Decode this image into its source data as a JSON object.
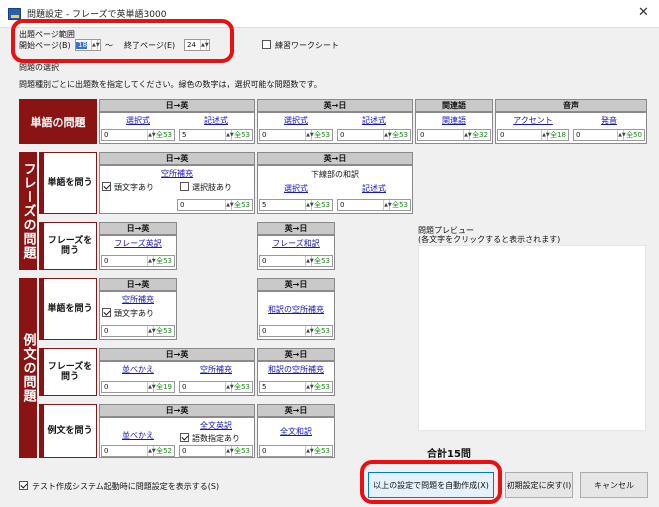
{
  "window": {
    "title": "問題設定 - フレーズで英単語3000",
    "close_label": "✕"
  },
  "range": {
    "group_label": "出題ページ範囲",
    "start_label": "開始ページ(B)",
    "start_value": "18",
    "tilde": "〜",
    "end_label": "終了ページ(E)",
    "end_value": "24",
    "worksheet_label": "練習ワークシート",
    "worksheet_checked": false
  },
  "selection": {
    "group_label": "問題の選択",
    "hint": "問題種別ごとに出題数を指定してください。緑色の数字は，選択可能な問題数です。"
  },
  "word": {
    "section_label": "単語の問題",
    "groups": [
      {
        "header": "日→英",
        "items": [
          {
            "label": "選択式",
            "value": "0",
            "total": "全53"
          },
          {
            "label": "記述式",
            "value": "5",
            "total": "全53"
          }
        ]
      },
      {
        "header": "英→日",
        "items": [
          {
            "label": "選択式",
            "value": "0",
            "total": "全53"
          },
          {
            "label": "記述式",
            "value": "0",
            "total": "全53"
          }
        ]
      },
      {
        "header": "関連語",
        "items": [
          {
            "label": "関連語",
            "value": "0",
            "total": "全32"
          }
        ]
      },
      {
        "header": "音声",
        "items": [
          {
            "label": "アクセント",
            "value": "0",
            "total": "全18"
          },
          {
            "label": "発音",
            "value": "0",
            "total": "全50"
          }
        ]
      }
    ]
  },
  "phrase": {
    "section_label": "フレーズの問題",
    "ask_word": {
      "label": "単語を問う",
      "ej": {
        "header": "日→英",
        "item": "空所補充",
        "opt1": "頭文字あり",
        "opt1_checked": true,
        "opt2": "選択肢あり",
        "opt2_checked": false,
        "value": "0",
        "total": "全53"
      },
      "je": {
        "header": "英→日",
        "sub": "下線部の和訳",
        "items": [
          {
            "label": "選択式",
            "value": "5",
            "total": "全53"
          },
          {
            "label": "記述式",
            "value": "0",
            "total": "全53"
          }
        ]
      }
    },
    "ask_phrase": {
      "label": "フレーズを問う",
      "ej": {
        "header": "日→英",
        "item": "フレーズ英訳",
        "value": "0",
        "total": "全53"
      },
      "je": {
        "header": "英→日",
        "item": "フレーズ和訳",
        "value": "0",
        "total": "全53"
      }
    }
  },
  "example": {
    "section_label": "例文の問題",
    "ask_word": {
      "label": "単語を問う",
      "ej": {
        "item": "空所補充",
        "opt": "頭文字あり",
        "opt_checked": true,
        "value": "0",
        "total": "全53"
      },
      "je": {
        "item": "和訳の空所補充",
        "value": "0",
        "total": "全53"
      }
    },
    "ask_phrase": {
      "label": "フレーズを問う",
      "ej": {
        "header": "日→英",
        "items": [
          {
            "label": "並べかえ",
            "value": "0",
            "total": "全19"
          },
          {
            "label": "空所補充",
            "value": "0",
            "total": "全53"
          }
        ]
      },
      "je": {
        "header": "英→日",
        "item": "和訳の空所補充",
        "value": "5",
        "total": "全53"
      }
    },
    "ask_sentence": {
      "label": "例文を問う",
      "ej": {
        "header": "日→英",
        "items": [
          {
            "label": "並べかえ",
            "value": "0",
            "total": "全52"
          },
          {
            "label": "全文英訳",
            "value": "0",
            "total": "全53"
          }
        ],
        "opt": "語数指定あり",
        "opt_checked": true
      },
      "je": {
        "header": "英→日",
        "item": "全文和訳",
        "value": "0",
        "total": "全53"
      }
    }
  },
  "preview": {
    "label": "問題プレビュー",
    "hint": "(各文字をクリックすると表示されます)"
  },
  "total": "合計15問",
  "footer": {
    "startup_label": "テスト作成システム起動時に問題設定を表示する(S)",
    "startup_checked": true,
    "auto_create": "以上の設定で問題を自動作成(X)",
    "reset": "初期設定に戻す(I)",
    "cancel": "キャンセル"
  },
  "colors": {
    "section": "#8a1414",
    "highlight": "#e81010",
    "total_green": "#1a8a1a",
    "link": "#1414c8"
  }
}
